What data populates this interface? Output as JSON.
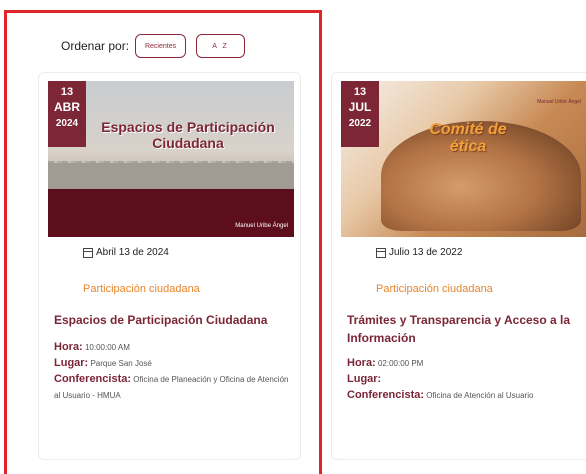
{
  "sort": {
    "label": "Ordenar por:",
    "recientes": "Recientes",
    "az": "A Z"
  },
  "events": [
    {
      "badge": {
        "day": "13",
        "month": "ABR",
        "year": "2024"
      },
      "image_title": "Espacios de Participación Ciudadana",
      "image_logo": "Manuel Uribe Ángel",
      "date": "Abril 13 de 2024",
      "category": "Participación ciudadana",
      "title": "Espacios de Participación Ciudadana",
      "hora_label": "Hora:",
      "hora": "10:00:00 AM",
      "lugar_label": "Lugar:",
      "lugar": "Parque San José",
      "conferencista_label": "Conferencista:",
      "conferencista": "Oficina de Planeación y Oficina de Atención al Usuario - HMUA"
    },
    {
      "badge": {
        "day": "13",
        "month": "JUL",
        "year": "2022"
      },
      "image_title": "Comité de ética",
      "image_logo": "Manuel Uribe Ángel",
      "date": "Julio 13 de 2022",
      "category": "Participación ciudadana",
      "title": "Trámites y Transparencia y Acceso a la Información",
      "hora_label": "Hora:",
      "hora": "02:00:00 PM",
      "lugar_label": "Lugar:",
      "lugar": "",
      "conferencista_label": "Conferencista:",
      "conferencista": "Oficina de Atención al Usuario"
    }
  ],
  "colors": {
    "accent": "#7c2636",
    "category": "#e6862b",
    "highlight": "#e0262b"
  }
}
